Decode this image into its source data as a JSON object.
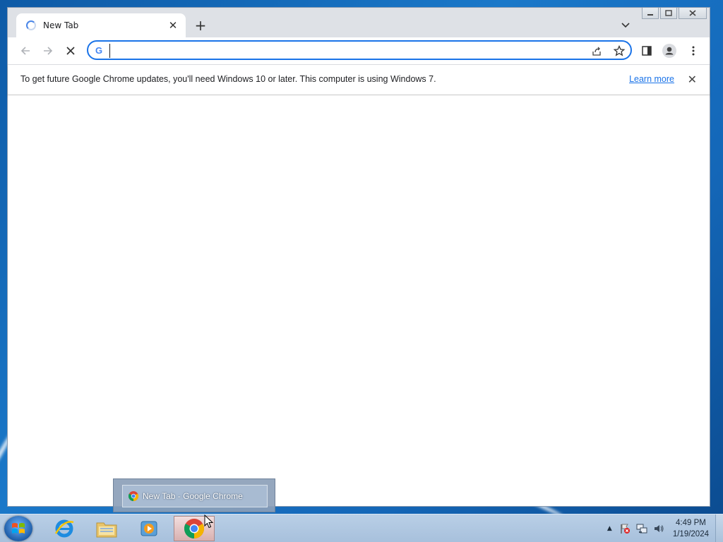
{
  "browser": {
    "tab_title": "New Tab",
    "new_tab_label": "+",
    "address_value": "",
    "infobar": {
      "message": "To get future Google Chrome updates, you'll need Windows 10 or later. This computer is using Windows 7.",
      "link": "Learn more"
    }
  },
  "taskbar": {
    "thumbnail_title": "New Tab - Google Chrome",
    "clock_time": "4:49 PM",
    "clock_date": "1/19/2024"
  },
  "colors": {
    "accent": "#1a73e8",
    "tab_strip": "#dee1e6",
    "desktop": "#1a78c9"
  }
}
